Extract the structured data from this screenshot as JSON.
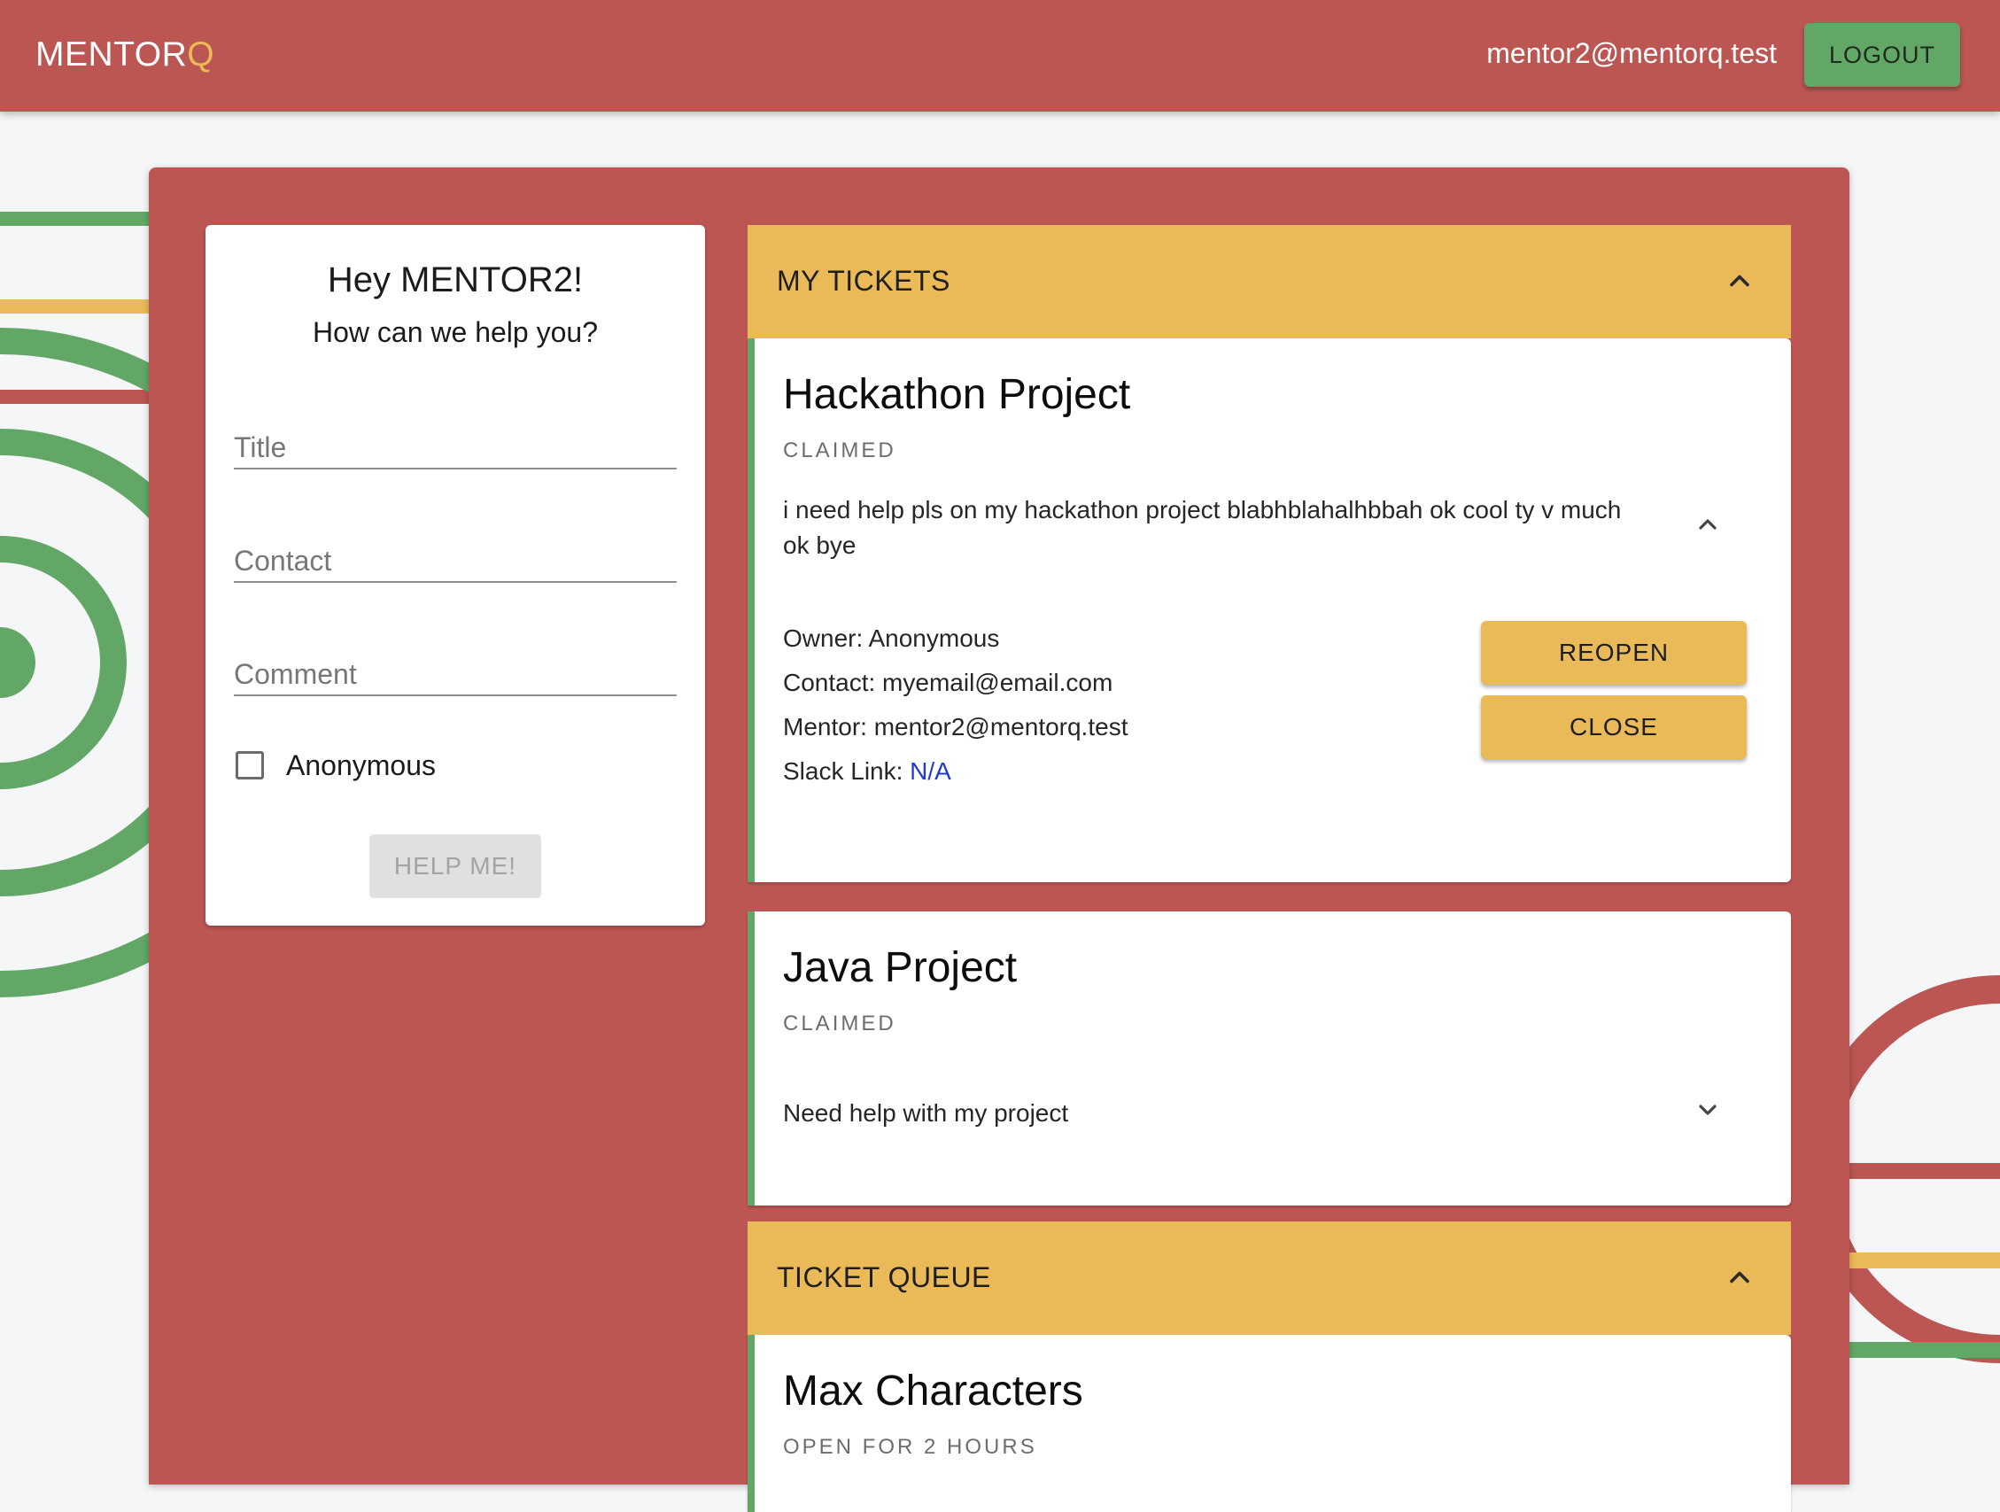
{
  "header": {
    "brand_main": "MENTOR",
    "brand_accent": "Q",
    "user_email": "mentor2@mentorq.test",
    "logout_label": "LOGOUT"
  },
  "help_form": {
    "greeting": "Hey MENTOR2!",
    "subtitle": "How can we help you?",
    "title_placeholder": "Title",
    "contact_placeholder": "Contact",
    "comment_placeholder": "Comment",
    "anonymous_label": "Anonymous",
    "anonymous_checked": false,
    "submit_label": "HELP ME!"
  },
  "my_tickets": {
    "title": "MY TICKETS",
    "tickets": [
      {
        "title": "Hackathon Project",
        "status": "CLAIMED",
        "description": "i need help pls on my hackathon project blabhblahalhbbah ok cool ty v much ok bye",
        "owner": "Owner: Anonymous",
        "contact": "Contact: myemail@email.com",
        "mentor": "Mentor: mentor2@mentorq.test",
        "slack_prefix": "Slack Link: ",
        "slack_value": "N/A",
        "reopen_label": "REOPEN",
        "close_label": "CLOSE"
      },
      {
        "title": "Java Project",
        "status": "CLAIMED",
        "description": "Need help with my project"
      }
    ]
  },
  "ticket_queue": {
    "title": "TICKET QUEUE",
    "tickets": [
      {
        "title": "Max Characters",
        "status": "OPEN FOR 2 HOURS"
      }
    ]
  },
  "colors": {
    "primary_red": "#bb5653",
    "accent_yellow": "#ebba58",
    "accent_green": "#62a765",
    "link_blue": "#1f3bd4"
  },
  "icons": {
    "section_toggle": "chevron-up-icon",
    "ticket_expanded": "chevron-up-icon",
    "ticket_collapsed": "chevron-down-icon",
    "checkbox": "checkbox-empty-icon"
  }
}
